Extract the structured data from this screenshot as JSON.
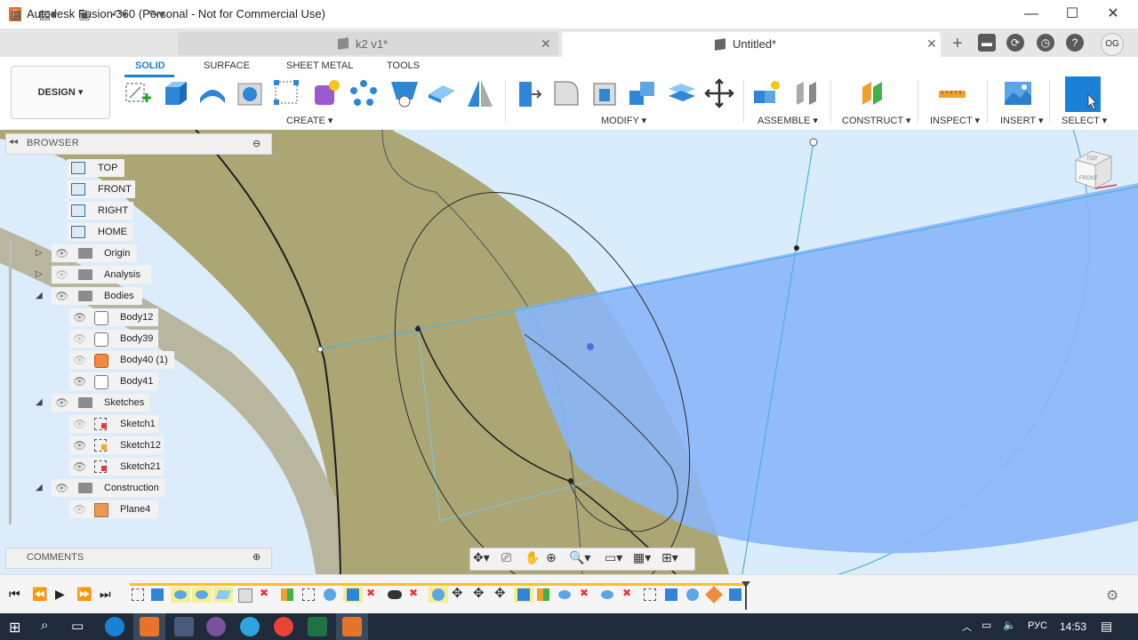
{
  "window": {
    "app_logo_letter": "F",
    "title": "Autodesk Fusion 360 (Personal - Not for Commercial Use)",
    "minimize": "—",
    "maximize": "☐",
    "close": "✕"
  },
  "tabs": [
    {
      "label": "k2 v1*",
      "active": false
    },
    {
      "label": "Untitled*",
      "active": true
    }
  ],
  "header": {
    "add_tab": "+",
    "user_initials": "OG"
  },
  "toolbar": {
    "workspace_button": "DESIGN ▾",
    "tabs": [
      "SOLID",
      "SURFACE",
      "SHEET METAL",
      "TOOLS"
    ],
    "groups": [
      "CREATE ▾",
      "MODIFY ▾",
      "ASSEMBLE ▾",
      "CONSTRUCT ▾",
      "INSPECT ▾",
      "INSERT ▾",
      "SELECT ▾"
    ]
  },
  "browser": {
    "title": "BROWSER",
    "named_views": [
      "TOP",
      "FRONT",
      "RIGHT",
      "HOME"
    ],
    "folders": [
      {
        "label": "Origin",
        "expanded": false
      },
      {
        "label": "Analysis",
        "expanded": false
      },
      {
        "label": "Bodies",
        "expanded": true
      },
      {
        "label": "Sketches",
        "expanded": true
      },
      {
        "label": "Construction",
        "expanded": true
      }
    ],
    "bodies": [
      "Body12",
      "Body39",
      "Body40 (1)",
      "Body41"
    ],
    "sketches": [
      "Sketch1",
      "Sketch12",
      "Sketch21"
    ],
    "construction": [
      "Plane4"
    ]
  },
  "comments": {
    "title": "COMMENTS"
  },
  "viewcube": {
    "top": "TOP",
    "front": "FRONT"
  },
  "taskbar": {
    "language": "РУС",
    "time": "14:53",
    "colors": {
      "fusion": "#e8732a",
      "calc": "#4a5a7a",
      "viber": "#7b519d",
      "telegram": "#2ca5e0",
      "chrome": "#e84335",
      "excel": "#1f7244",
      "other": "#e8732a"
    }
  }
}
